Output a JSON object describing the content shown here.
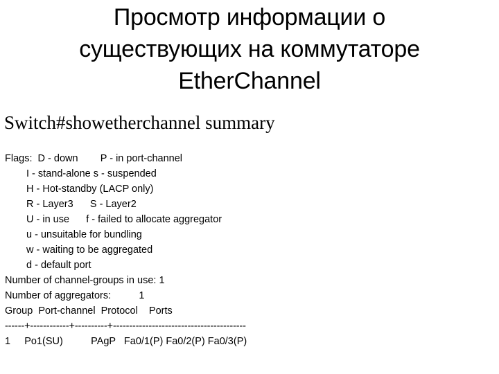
{
  "slide": {
    "background_color": "#ffffff",
    "text_color": "#000000"
  },
  "title": {
    "full_text": "Просмотр информации о существующих на коммутаторе EtherChannel",
    "lines": [
      "Просмотр информации о",
      "существующих на коммутаторе",
      "EtherChannel"
    ]
  },
  "command": {
    "prompt_and_command": "Switch#showetherchannel summary",
    "hostname_prompt": "Switch#",
    "command_text": "showetherchannel summary"
  },
  "console_output": {
    "flags_legend": [
      "Flags:  D - down        P - in port-channel",
      "I - stand-alone s - suspended",
      "H - Hot-standby (LACP only)",
      "R - Layer3      S - Layer2",
      "U - in use      f - failed to allocate aggregator",
      "u - unsuitable for bundling",
      "w - waiting to be aggregated",
      "d - default port"
    ],
    "flag_definitions": [
      {
        "flag": "D",
        "meaning": "down"
      },
      {
        "flag": "P",
        "meaning": "in port-channel"
      },
      {
        "flag": "I",
        "meaning": "stand-alone"
      },
      {
        "flag": "s",
        "meaning": "suspended"
      },
      {
        "flag": "H",
        "meaning": "Hot-standby (LACP only)"
      },
      {
        "flag": "R",
        "meaning": "Layer3"
      },
      {
        "flag": "S",
        "meaning": "Layer2"
      },
      {
        "flag": "U",
        "meaning": "in use"
      },
      {
        "flag": "f",
        "meaning": "failed to allocate aggregator"
      },
      {
        "flag": "u",
        "meaning": "unsuitable for bundling"
      },
      {
        "flag": "w",
        "meaning": "waiting to be aggregated"
      },
      {
        "flag": "d",
        "meaning": "default port"
      }
    ],
    "counters": [
      "Number of channel-groups in use: 1",
      "Number of aggregators:          1"
    ],
    "channel_groups_in_use": "1",
    "aggregators": "1",
    "table_header": "Group  Port-channel  Protocol    Ports",
    "table_rule": "------+------------+----------+-----------------------------------------",
    "table_rows": [
      "1     Po1(SU)          PAgP   Fa0/1(P) Fa0/2(P) Fa0/3(P)"
    ],
    "table_columns": [
      "Group",
      "Port-channel",
      "Protocol",
      "Ports"
    ],
    "table_values": [
      {
        "group": "1",
        "port_channel": "Po1(SU)",
        "protocol": "PAgP",
        "ports": "Fa0/1(P) Fa0/2(P) Fa0/3(P)"
      }
    ]
  }
}
